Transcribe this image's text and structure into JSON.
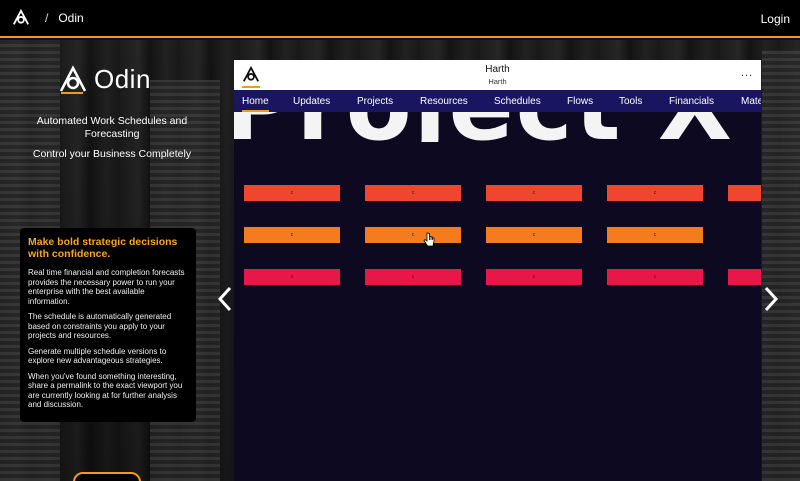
{
  "topbar": {
    "separator": "/",
    "breadcrumb": "Odin",
    "login_label": "Login",
    "accent_color": "#f39c12"
  },
  "left": {
    "brand_name": "Odin",
    "tagline": "Automated Work Schedules and Forecasting",
    "tagline2": "Control your Business Completely",
    "card": {
      "heading": "Make bold strategic decisions with confidence.",
      "paragraphs": [
        "Real time financial and completion forecasts provides the necessary power to run your enterprise with the best available information.",
        "The schedule is automatically generated based on constraints you apply to your projects and resources.",
        "Generate multiple schedule versions to explore new advantageous strategies.",
        "When you've found something interesting, share a permalink to the exact viewport you are currently looking at for further analysis and discussion."
      ]
    }
  },
  "carousel": {
    "prev_icon": "chevron-left-icon",
    "next_icon": "chevron-right-icon"
  },
  "app": {
    "title": "Harth",
    "subtitle": "Harth",
    "more_label": "...",
    "tabs": [
      "Home",
      "Updates",
      "Projects",
      "Resources",
      "Schedules",
      "Flows",
      "Tools",
      "Financials",
      "Mate"
    ],
    "active_tab": "Home",
    "project_title": "Project X",
    "bar_label": "c",
    "rows": [
      {
        "color": "#f0452f",
        "count": 5
      },
      {
        "color": "#f57b1f",
        "count": 4
      },
      {
        "color": "#e8174a",
        "count": 5
      }
    ]
  }
}
